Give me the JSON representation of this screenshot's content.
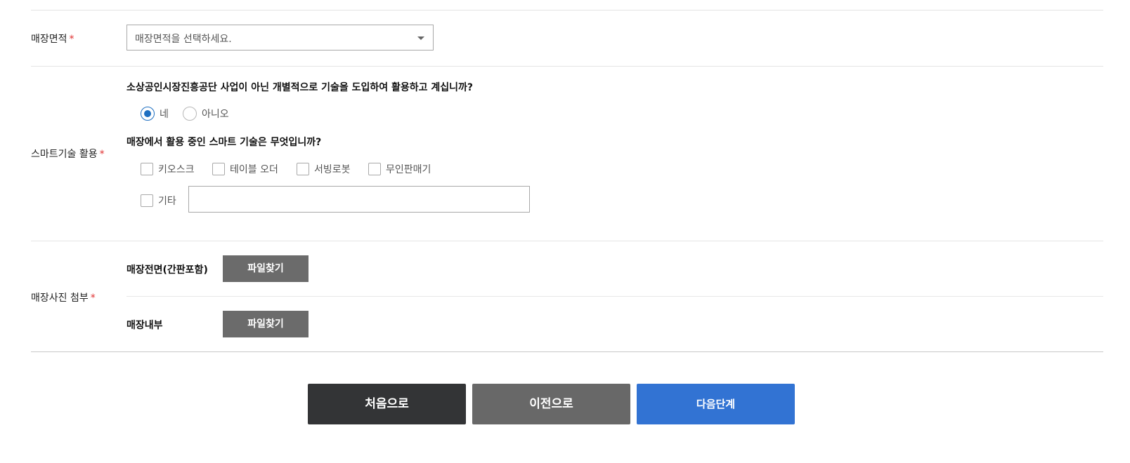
{
  "store_area": {
    "label": "매장면적",
    "required_mark": "*",
    "select_placeholder": "매장면적을 선택하세요."
  },
  "smart_tech": {
    "label": "스마트기술 활용",
    "required_mark": "*",
    "question1": "소상공인시장진흥공단 사업이 아닌 개별적으로 기술을 도입하여 활용하고 계십니까?",
    "radio_yes": "네",
    "radio_no": "아니오",
    "selected": "네",
    "question2": "매장에서 활용 중인 스마트 기술은 무엇입니까?",
    "options": [
      "키오스크",
      "테이블 오더",
      "서빙로봇",
      "무인판매기",
      "기타"
    ],
    "etc_value": ""
  },
  "photos": {
    "label": "매장사진 첨부",
    "required_mark": "*",
    "front_label": "매장전면(간판포함)",
    "inside_label": "매장내부",
    "find_file": "파일찾기"
  },
  "buttons": {
    "first": "처음으로",
    "prev": "이전으로",
    "next": "다음단계"
  },
  "colors": {
    "required": "#e03131",
    "radio_accent": "#1e6fc1",
    "file_button": "#6b6b6b",
    "btn_first": "#333436",
    "btn_prev": "#686868",
    "btn_next": "#3273d3"
  }
}
